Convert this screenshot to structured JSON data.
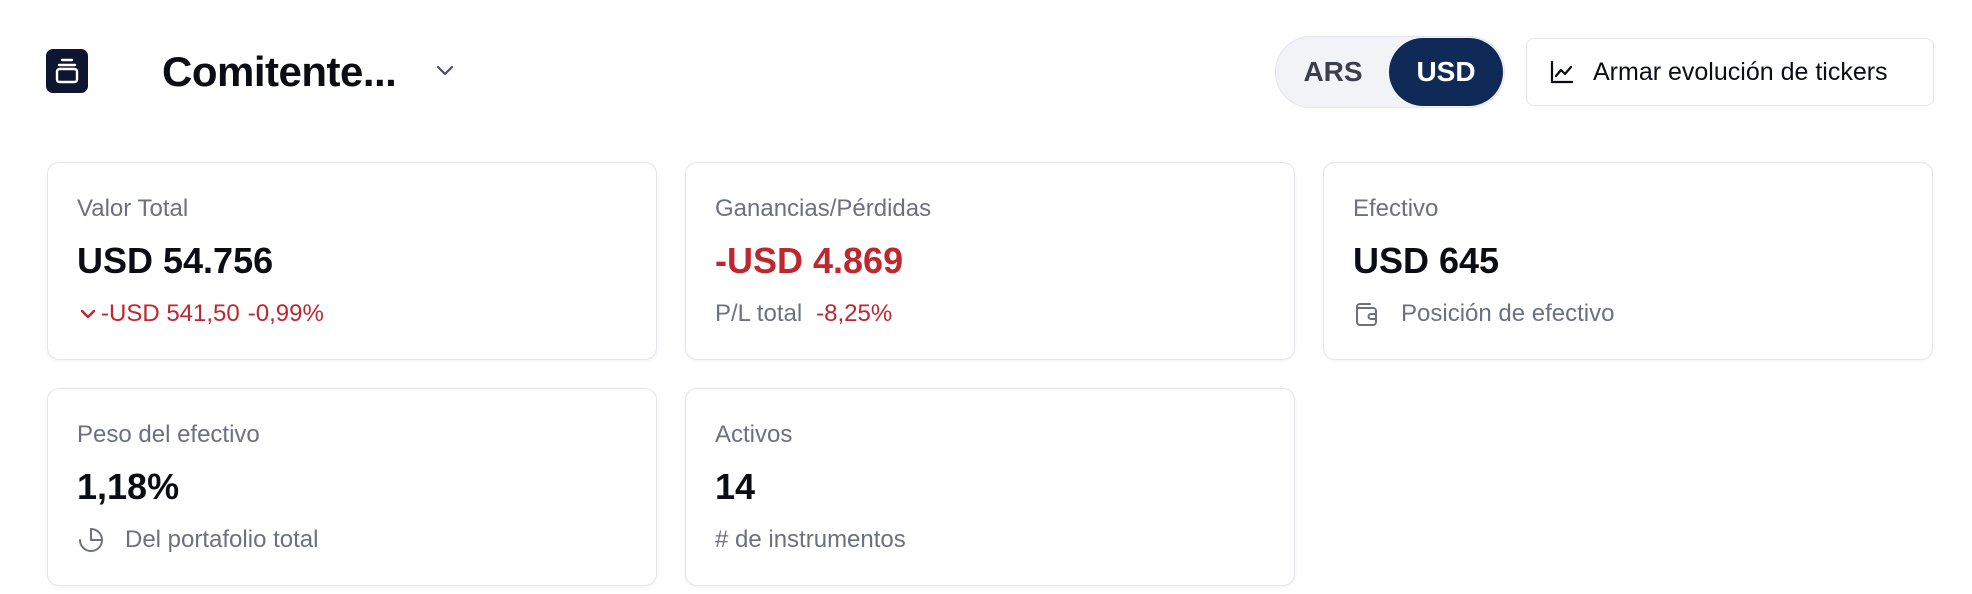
{
  "header": {
    "account_title": "Comitente...",
    "currency_options": [
      "ARS",
      "USD"
    ],
    "currency_selected": "USD",
    "evolution_button_label": "Armar evolución de tickers"
  },
  "cards": {
    "total_value": {
      "label": "Valor Total",
      "value": "USD 54.756",
      "change_amount": "-USD 541,50",
      "change_percent": "-0,99%"
    },
    "pnl": {
      "label": "Ganancias/Pérdidas",
      "value": "-USD 4.869",
      "sub_label": "P/L total",
      "sub_percent": "-8,25%"
    },
    "cash": {
      "label": "Efectivo",
      "value": "USD 645",
      "sub_label": "Posición de efectivo"
    },
    "cash_weight": {
      "label": "Peso del efectivo",
      "value": "1,18%",
      "sub_label": "Del portafolio total"
    },
    "assets": {
      "label": "Activos",
      "value": "14",
      "sub_label": "# de instrumentos"
    }
  },
  "colors": {
    "accent": "#0f2a57",
    "negative": "#c0262d",
    "muted_text": "#6b7180"
  },
  "icons": {
    "logo": "layers-icon",
    "account": "chevron-down-icon",
    "evolution": "line-chart-icon",
    "change": "chevron-down-icon",
    "cash": "wallet-icon",
    "cash_weight": "pie-chart-icon"
  }
}
